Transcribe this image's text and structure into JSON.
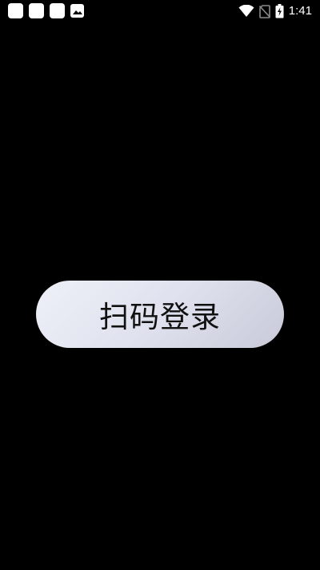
{
  "status_bar": {
    "time": "1:41",
    "notification_icons": [
      "app-notification-icon",
      "app-notification-icon",
      "app-notification-icon",
      "gallery-icon"
    ],
    "system_icons": [
      "wifi-icon",
      "no-sim-icon",
      "battery-charging-icon"
    ]
  },
  "main": {
    "login_button_label": "扫码登录"
  },
  "colors": {
    "background": "#000000",
    "button_gradient_start": "#eef0f8",
    "button_gradient_end": "#c9cad9",
    "button_text": "#111111"
  }
}
